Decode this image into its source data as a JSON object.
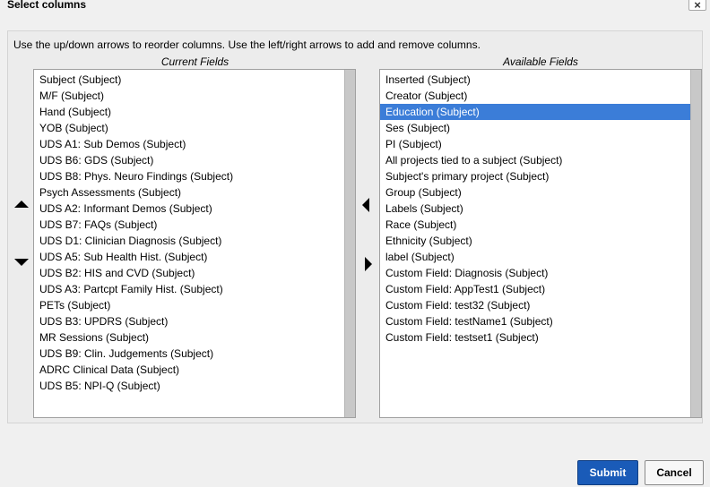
{
  "dialog": {
    "title": "Select columns",
    "close_label": "×",
    "instructions": "Use the up/down arrows to reorder columns. Use the left/right arrows to add and remove columns."
  },
  "current": {
    "header": "Current Fields",
    "items": [
      "Subject (Subject)",
      "M/F (Subject)",
      "Hand (Subject)",
      "YOB (Subject)",
      "UDS A1: Sub Demos (Subject)",
      "UDS B6: GDS (Subject)",
      "UDS B8: Phys. Neuro Findings (Subject)",
      "Psych Assessments (Subject)",
      "UDS A2: Informant Demos (Subject)",
      "UDS B7: FAQs (Subject)",
      "UDS D1: Clinician Diagnosis (Subject)",
      "UDS A5: Sub Health Hist. (Subject)",
      "UDS B2: HIS and CVD (Subject)",
      "UDS A3: Partcpt Family Hist. (Subject)",
      "PETs (Subject)",
      "UDS B3: UPDRS (Subject)",
      "MR Sessions (Subject)",
      "UDS B9: Clin. Judgements (Subject)",
      "ADRC Clinical Data (Subject)",
      "UDS B5: NPI-Q (Subject)"
    ]
  },
  "available": {
    "header": "Available Fields",
    "selected_index": 2,
    "items": [
      "Inserted (Subject)",
      "Creator (Subject)",
      "Education (Subject)",
      "Ses (Subject)",
      "PI (Subject)",
      "All projects tied to a subject (Subject)",
      "Subject's primary project (Subject)",
      "Group (Subject)",
      "Labels (Subject)",
      "Race (Subject)",
      "Ethnicity (Subject)",
      "label (Subject)",
      "Custom Field: Diagnosis (Subject)",
      "Custom Field: AppTest1 (Subject)",
      "Custom Field: test32 (Subject)",
      "Custom Field: testName1 (Subject)",
      "Custom Field: testset1 (Subject)"
    ]
  },
  "icons": {
    "move_up": "arrow-up-icon",
    "move_down": "arrow-down-icon",
    "add": "arrow-left-icon",
    "remove": "arrow-right-icon"
  },
  "colors": {
    "selection": "#3b7dd8",
    "submit": "#1a5bb8"
  },
  "footer": {
    "submit_label": "Submit",
    "cancel_label": "Cancel"
  }
}
